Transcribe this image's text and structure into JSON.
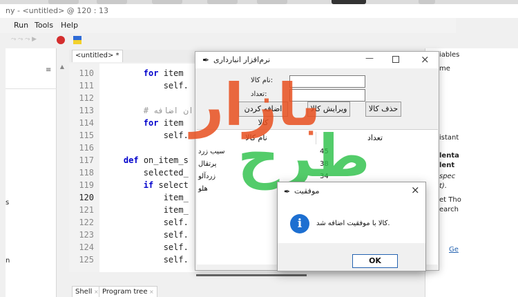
{
  "thonny": {
    "title": "ny  -  <untitled>  @  120 : 13",
    "menu": [
      "Run",
      "Tools",
      "Help"
    ],
    "editor_tab": "<untitled> *",
    "bottom_tabs": [
      "Shell",
      "Program tree"
    ],
    "left_fragments": [
      "s",
      "n"
    ],
    "right_fragments": {
      "header": "iables",
      "line1": "me",
      "line2": "istant",
      "bold1": "lenta",
      "bold2": "lent",
      "italic1": "spec",
      "italic2": "t).",
      "line3": "et Tho",
      "line4": "earch",
      "link": "Ge"
    }
  },
  "code_lines": [
    {
      "no": "110",
      "indent": "        ",
      "kw": "for",
      "rest": " item"
    },
    {
      "no": "111",
      "indent": "            ",
      "kw": "",
      "rest": "self."
    },
    {
      "no": "112",
      "indent": "",
      "kw": "",
      "rest": ""
    },
    {
      "no": "113",
      "indent": "        ",
      "kw": "",
      "rest": "# ",
      "comment": "ان اضافه"
    },
    {
      "no": "114",
      "indent": "        ",
      "kw": "for",
      "rest": " item"
    },
    {
      "no": "115",
      "indent": "            ",
      "kw": "",
      "rest": "self."
    },
    {
      "no": "116",
      "indent": "",
      "kw": "",
      "rest": ""
    },
    {
      "no": "117",
      "indent": "    ",
      "kw": "def",
      "rest": " on_item_s"
    },
    {
      "no": "118",
      "indent": "        ",
      "kw": "",
      "rest": "selected_"
    },
    {
      "no": "119",
      "indent": "        ",
      "kw": "if",
      "rest": " select"
    },
    {
      "no": "120",
      "indent": "            ",
      "kw": "",
      "rest": "item_"
    },
    {
      "no": "121",
      "indent": "            ",
      "kw": "",
      "rest": "item_"
    },
    {
      "no": "122",
      "indent": "            ",
      "kw": "",
      "rest": "self."
    },
    {
      "no": "123",
      "indent": "            ",
      "kw": "",
      "rest": "self."
    },
    {
      "no": "124",
      "indent": "            ",
      "kw": "",
      "rest": "self."
    },
    {
      "no": "125",
      "indent": "            ",
      "kw": "",
      "rest": "self."
    }
  ],
  "inventory_window": {
    "title": "نرم‌افزار انبارداری",
    "name_label": ":نام کالا",
    "qty_label": ":تعداد",
    "name_value": "",
    "qty_value": "",
    "buttons": {
      "add": "اضافه کردن کالا",
      "edit": "ویرایش کالا",
      "delete": "حذف کالا"
    },
    "columns": {
      "name": "نام کالا",
      "qty": "تعداد"
    },
    "rows": [
      {
        "name": "سیب زرد",
        "qty": "45"
      },
      {
        "name": "پرتقال",
        "qty": "38"
      },
      {
        "name": "زردآلو",
        "qty": "34"
      },
      {
        "name": "هلو",
        "qty": ""
      }
    ]
  },
  "watermark": {
    "line1": "بازار",
    "line2": "طرح"
  },
  "dialog": {
    "title": "موفقیت",
    "message": ".کالا با موفقیت اضافه شد",
    "ok": "OK"
  },
  "colors": {
    "accent": "#1d6fd1",
    "watermark_red": "#e8501f",
    "watermark_green": "#2ec24a"
  },
  "icons": [
    "feather-icon",
    "close-icon",
    "minimize-icon",
    "maximize-icon",
    "info-icon",
    "stop-icon",
    "flag-icon",
    "menu-lines-icon"
  ]
}
